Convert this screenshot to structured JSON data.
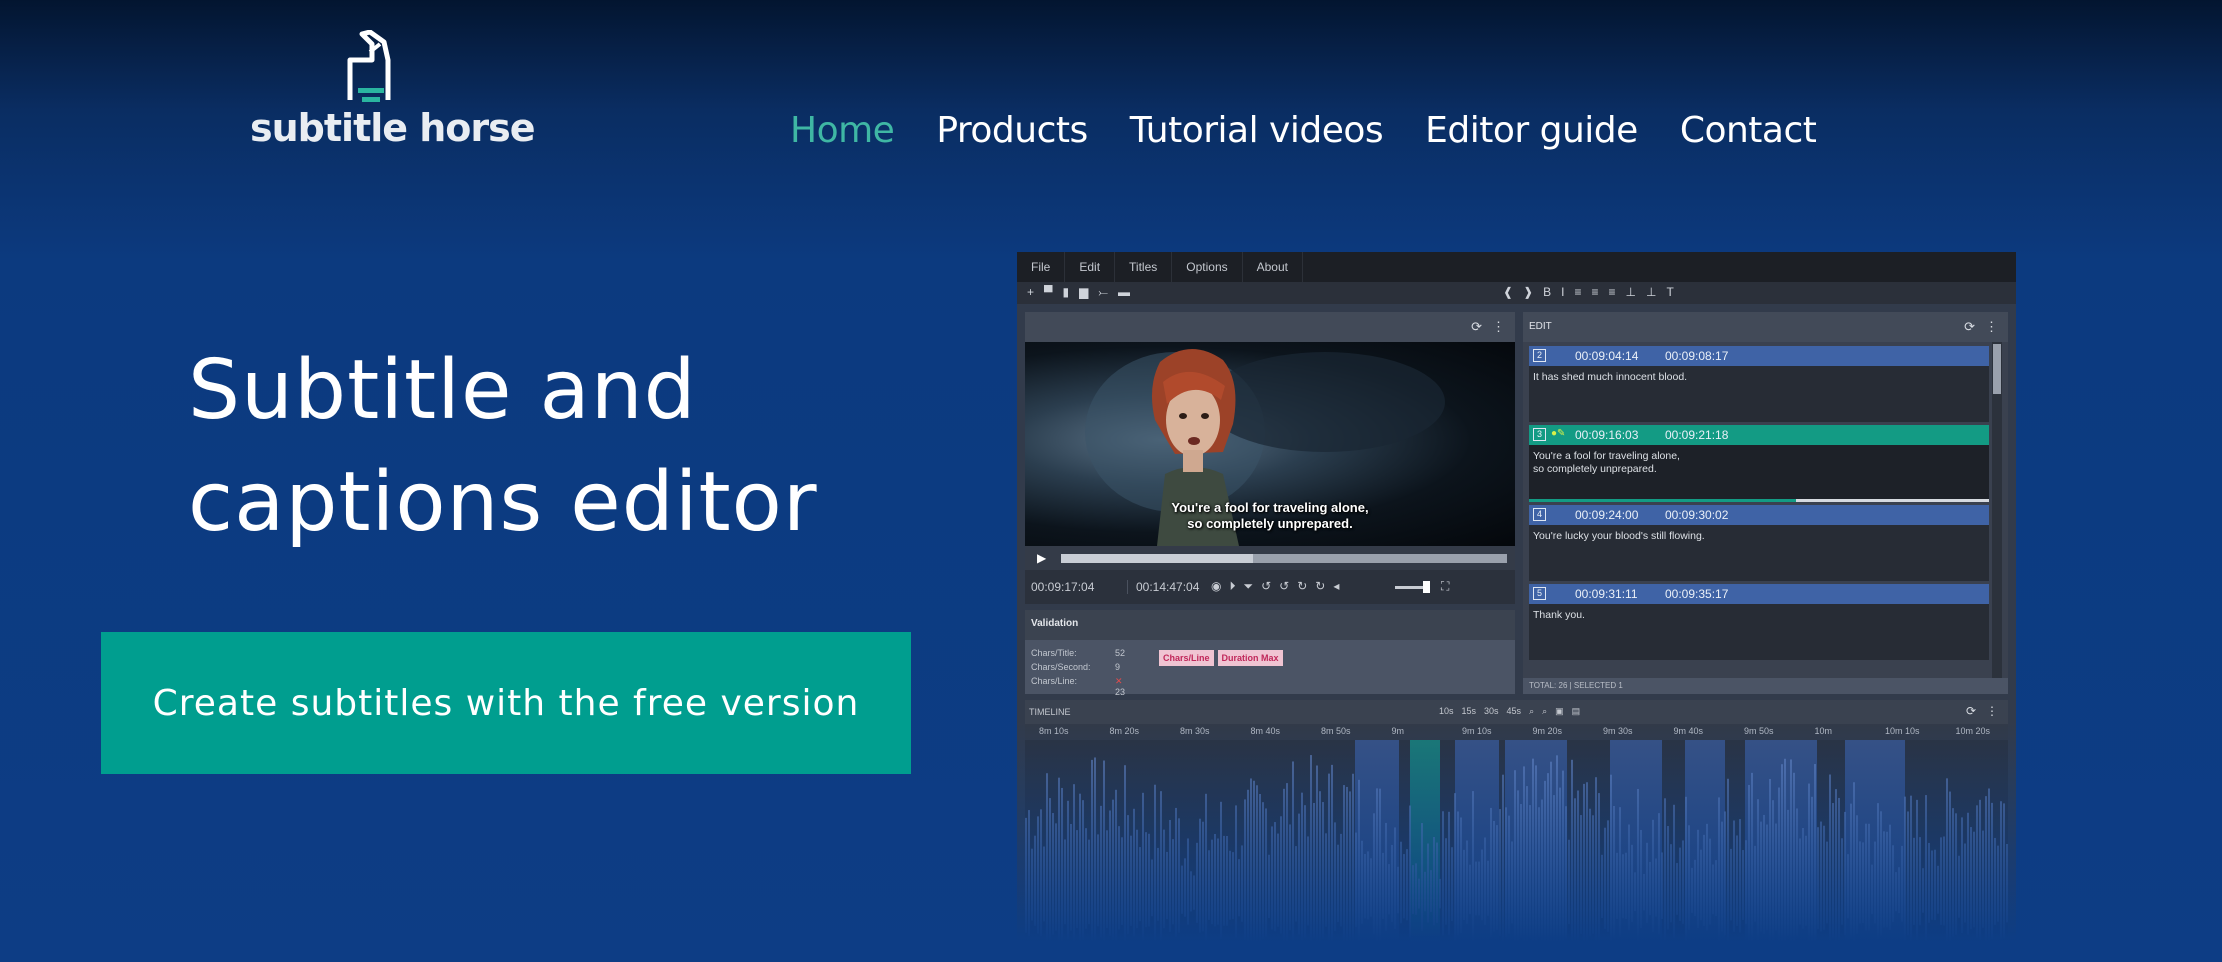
{
  "brand": {
    "name": "subtitle horse"
  },
  "nav": {
    "items": [
      "Home",
      "Products",
      "Tutorial videos",
      "Editor guide",
      "Contact"
    ],
    "active_index": 0
  },
  "hero": {
    "title_line1": "Subtitle and",
    "title_line2": "captions editor",
    "cta_label": "Create subtitles with the free version"
  },
  "colors": {
    "accent": "#009e8f",
    "nav_active": "#3fb7a4",
    "background": "#0d3d85"
  },
  "editor": {
    "menu": [
      "File",
      "Edit",
      "Titles",
      "Options",
      "About"
    ],
    "toolbar_left": [
      "+",
      "▀",
      "▮",
      "▆",
      "⤚",
      "▬"
    ],
    "toolbar_right": [
      "❰",
      "❱",
      "B",
      "I",
      "≡",
      "≡",
      "≡",
      "⊥",
      "⊥",
      "T"
    ],
    "video": {
      "caption_line1": "You're a fool for traveling alone,",
      "caption_line2": "so completely unprepared.",
      "time_current": "00:09:17:04",
      "time_total": "00:14:47:04",
      "progress": 0.43
    },
    "validation": {
      "title": "Validation",
      "rows": [
        {
          "label": "Chars/Title:",
          "value": "52"
        },
        {
          "label": "Chars/Second:",
          "value": "9"
        },
        {
          "label": "Chars/Line:",
          "value": "23"
        }
      ],
      "badges": [
        "Chars/Line",
        "Duration Max"
      ]
    },
    "edit": {
      "title": "EDIT",
      "entries": [
        {
          "num": "2",
          "in": "00:09:04:14",
          "out": "00:09:08:17",
          "text": "It has shed much innocent blood."
        },
        {
          "num": "3",
          "in": "00:09:16:03",
          "out": "00:09:21:18",
          "text": "You're a fool for traveling alone,\nso completely unprepared.",
          "active": true
        },
        {
          "num": "4",
          "in": "00:09:24:00",
          "out": "00:09:30:02",
          "text": "You're lucky your blood's still flowing."
        },
        {
          "num": "5",
          "in": "00:09:31:11",
          "out": "00:09:35:17",
          "text": "Thank you."
        }
      ],
      "status": "TOTAL: 26 | SELECTED 1"
    },
    "timeline": {
      "title": "TIMELINE",
      "zoom_options": [
        "10s",
        "15s",
        "30s",
        "45s"
      ],
      "ruler": [
        "8m 10s",
        "8m 20s",
        "8m 30s",
        "8m 40s",
        "8m 50s",
        "9m",
        "9m 10s",
        "9m 20s",
        "9m 30s",
        "9m 40s",
        "9m 50s",
        "10m",
        "10m 10s",
        "10m 20s"
      ]
    }
  }
}
